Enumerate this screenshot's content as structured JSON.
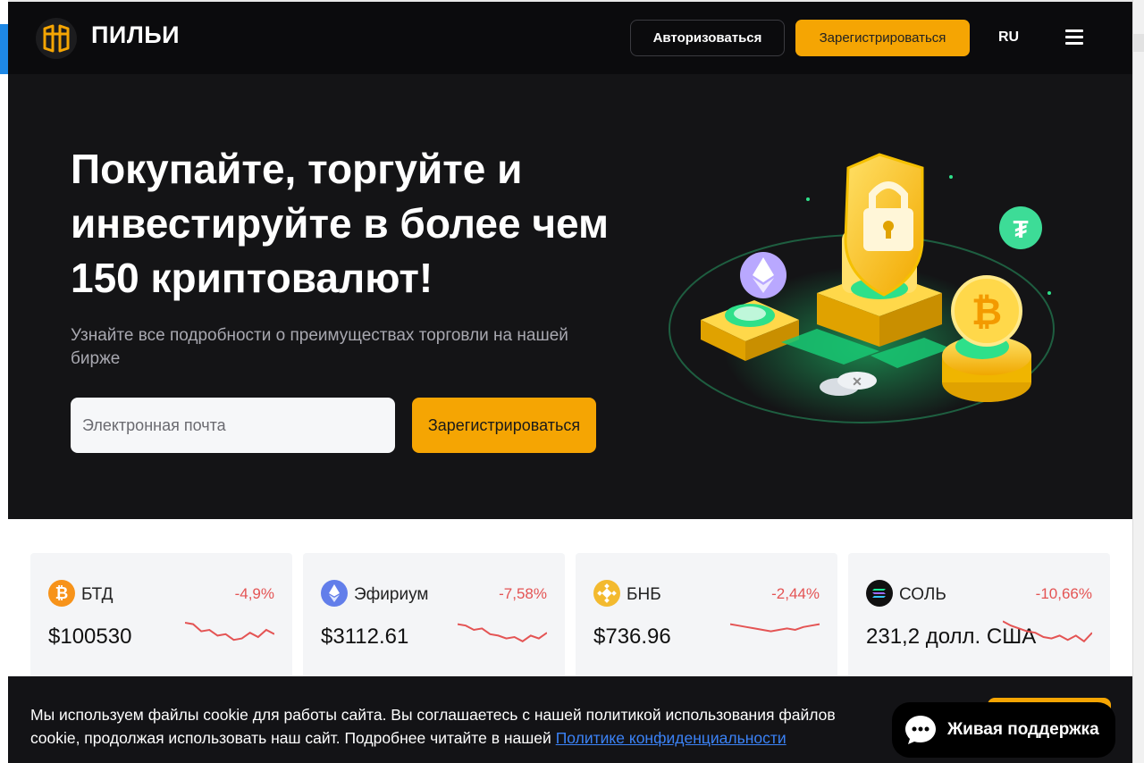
{
  "header": {
    "logo_text": "ПИЛЬИ",
    "login_label": "Авторизоваться",
    "register_label": "Зарегистрироваться",
    "language": "RU"
  },
  "hero": {
    "title": "Покупайте, торгуйте и инвестируйте в более чем 150 криптовалют!",
    "subtitle": "Узнайте все подробности о преимуществах торговли на нашей бирже",
    "email_placeholder": "Электронная почта",
    "register_label": "Зарегистрироваться"
  },
  "tickers": [
    {
      "name": "БТД",
      "change": "-4,9%",
      "price": "$100530",
      "icon": "bitcoin-icon",
      "color": "#f7931a",
      "spark": [
        0.25,
        0.3,
        0.55,
        0.5,
        0.7,
        0.65,
        0.85,
        0.8,
        0.6,
        0.75,
        0.5,
        0.65
      ]
    },
    {
      "name": "Эфириум",
      "change": "-7,58%",
      "price": "$3112.61",
      "icon": "ethereum-icon",
      "color": "#627eea",
      "spark": [
        0.3,
        0.35,
        0.5,
        0.45,
        0.65,
        0.7,
        0.8,
        0.75,
        0.9,
        0.7,
        0.8,
        0.6
      ]
    },
    {
      "name": "БНБ",
      "change": "-2,44%",
      "price": "$736.96",
      "icon": "bnb-icon",
      "color": "#f3ba2f",
      "spark": [
        0.3,
        0.35,
        0.4,
        0.45,
        0.5,
        0.55,
        0.5,
        0.45,
        0.5,
        0.4,
        0.35,
        0.3
      ]
    },
    {
      "name": "СОЛЬ",
      "change": "-10,66%",
      "price": "231,2 долл. США",
      "icon": "solana-icon",
      "color": "#111111",
      "spark": [
        0.2,
        0.35,
        0.45,
        0.55,
        0.6,
        0.75,
        0.8,
        0.7,
        0.85,
        0.7,
        0.9,
        0.6
      ]
    }
  ],
  "cookie": {
    "text": "Мы используем файлы cookie для работы сайта. Вы соглашаетесь с нашей политикой использования файлов cookie, продолжая использовать наш сайт. Подробнее читайте в нашей",
    "link": "Политике конфиденциальности"
  },
  "support": {
    "label": "Живая поддержка"
  },
  "colors": {
    "accent": "#f5a503",
    "negative": "#e45454",
    "header_bg": "#0b0b0d",
    "hero_bg": "#141416"
  }
}
